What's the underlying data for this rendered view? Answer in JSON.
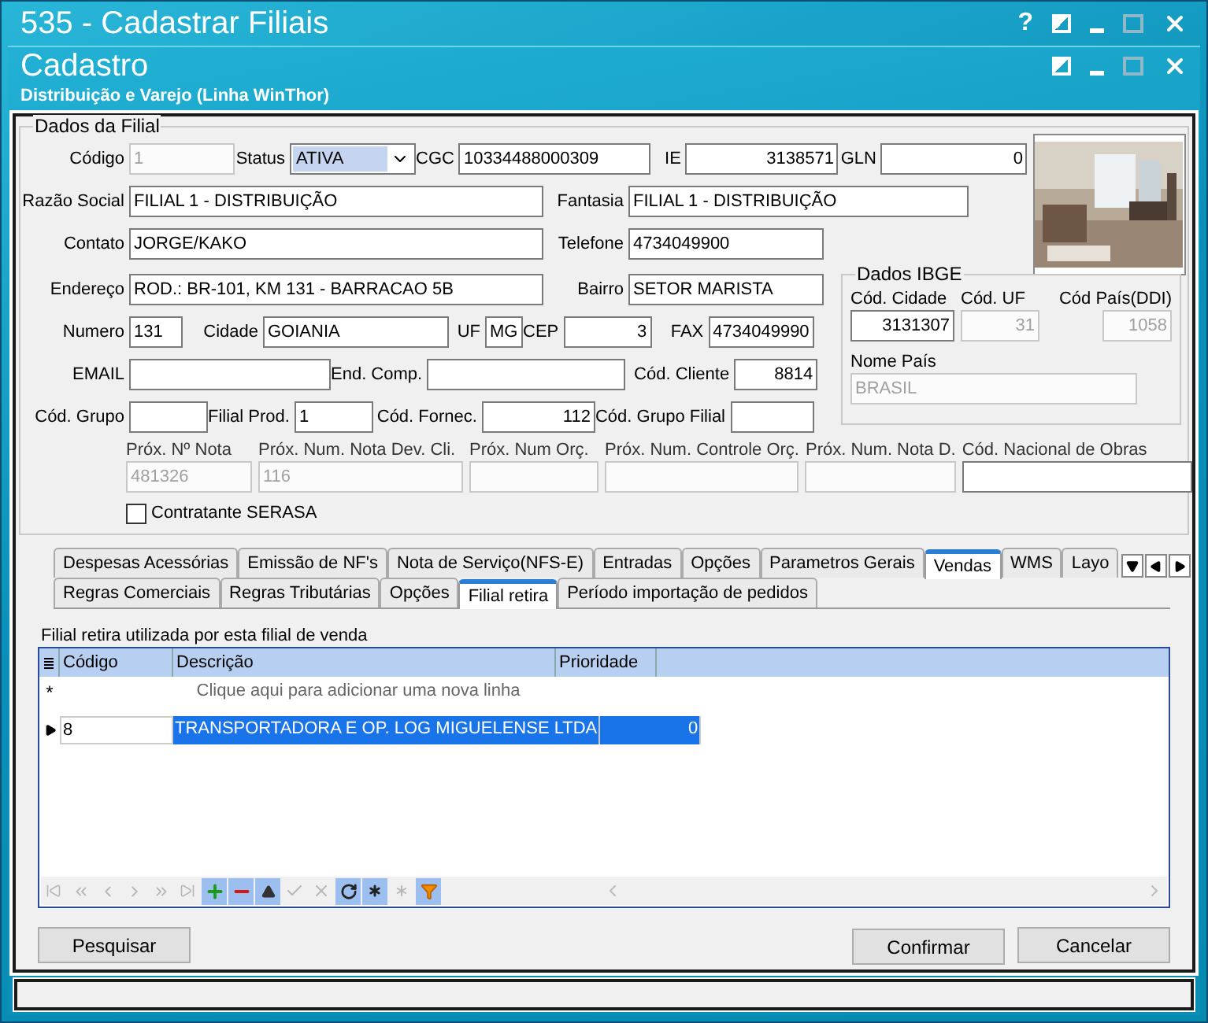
{
  "parent_window": {
    "title": "535 - Cadastrar Filiais",
    "help": "?"
  },
  "window": {
    "title": "Cadastro",
    "subtitle": "Distribuição e Varejo (Linha WinThor)",
    "maximize_disabled": true
  },
  "dados_filial": {
    "title": "Dados da Filial",
    "fields": {
      "codigo": {
        "label": "Código",
        "value": "1",
        "disabled": true
      },
      "status": {
        "label": "Status",
        "value": "ATIVA",
        "kind": "select"
      },
      "cgc": {
        "label": "CGC",
        "value": "10334488000309"
      },
      "ie": {
        "label": "IE",
        "value": "3138571"
      },
      "gln": {
        "label": "GLN",
        "value": "0"
      },
      "razao": {
        "label": "Razão Social",
        "value": "FILIAL 1 - DISTRIBUIÇÃO"
      },
      "fantasia": {
        "label": "Fantasia",
        "value": "FILIAL 1 - DISTRIBUIÇÃO"
      },
      "contato": {
        "label": "Contato",
        "value": "JORGE/KAKO"
      },
      "telefone": {
        "label": "Telefone",
        "value": "4734049900"
      },
      "endereco": {
        "label": "Endereço",
        "value": "ROD.: BR-101, KM 131 - BARRACAO 5B"
      },
      "bairro": {
        "label": "Bairro",
        "value": "SETOR MARISTA"
      },
      "numero": {
        "label": "Numero",
        "value": "131"
      },
      "cidade": {
        "label": "Cidade",
        "value": "GOIANIA"
      },
      "uf": {
        "label": "UF",
        "value": "MG"
      },
      "cep": {
        "label": "CEP",
        "value": "3"
      },
      "fax": {
        "label": "FAX",
        "value": "4734049990"
      },
      "email": {
        "label": "EMAIL"
      },
      "end_comp": {
        "label": "End. Comp."
      },
      "cod_cliente": {
        "label": "Cód. Cliente",
        "value": "8814"
      },
      "cod_grupo": {
        "label": "Cód. Grupo"
      },
      "filial_prod": {
        "label": "Filial Prod.",
        "value": "1"
      },
      "cod_fornec": {
        "label": "Cód. Fornec.",
        "value": "112"
      },
      "cod_grupo_filial": {
        "label": "Cód. Grupo Filial"
      }
    },
    "numbering": [
      {
        "label": "Próx. Nº Nota",
        "value": "481326",
        "disabled": true
      },
      {
        "label": "Próx. Num. Nota Dev. Cli.",
        "value": "116",
        "disabled": true
      },
      {
        "label": "Próx. Num Orç.",
        "disabled": true
      },
      {
        "label": "Próx. Num. Controle Orç.",
        "disabled": true
      },
      {
        "label": "Próx. Num. Nota D.",
        "disabled": true
      },
      {
        "label": "Cód. Nacional de Obras",
        "disabled": false
      }
    ],
    "serasa": {
      "label": "Contratante SERASA",
      "checked": false
    },
    "ibge": {
      "title": "Dados IBGE",
      "fields": [
        {
          "label": "Cód. Cidade",
          "value": "3131307",
          "disabled": false
        },
        {
          "label": "Cód. UF",
          "value": "31",
          "disabled": true
        },
        {
          "label": "Cód País(DDI)",
          "value": "1058",
          "disabled": true
        }
      ],
      "pais": {
        "label": "Nome País",
        "value": "BRASIL",
        "disabled": true
      }
    }
  },
  "tabs": [
    {
      "label": "Despesas Acessórias",
      "selected": false
    },
    {
      "label": "Emissão de NF's",
      "selected": false
    },
    {
      "label": "Nota de Serviço(NFS-E)",
      "selected": false
    },
    {
      "label": "Entradas",
      "selected": false
    },
    {
      "label": "Opções",
      "selected": false
    },
    {
      "label": "Parametros Gerais",
      "selected": false
    },
    {
      "label": "Vendas",
      "selected": true
    },
    {
      "label": "WMS",
      "selected": false
    },
    {
      "label": "Layo",
      "selected": false
    }
  ],
  "subtabs": [
    {
      "label": "Regras Comerciais",
      "selected": false
    },
    {
      "label": "Regras Tributárias",
      "selected": false
    },
    {
      "label": "Opções",
      "selected": false
    },
    {
      "label": "Filial retira",
      "selected": true
    },
    {
      "label": "Período importação de pedidos",
      "selected": false
    }
  ],
  "grid": {
    "caption": "Filial retira utilizada por esta filial de venda",
    "columns": [
      "Código",
      "Descrição",
      "Prioridade"
    ],
    "new_row": {
      "marker": "*",
      "text": "Clique aqui para adicionar uma nova linha"
    },
    "rows": [
      {
        "cells": [
          "8",
          "TRANSPORTADORA E OP. LOG MIGUELENSE LTDA",
          "0"
        ],
        "selected": true
      }
    ],
    "navigator": [
      {
        "kind": "first",
        "disabled": true
      },
      {
        "kind": "prev_page",
        "disabled": true
      },
      {
        "kind": "prev",
        "disabled": true
      },
      {
        "kind": "next",
        "disabled": true
      },
      {
        "kind": "next_page",
        "disabled": true
      },
      {
        "kind": "last",
        "disabled": true
      },
      {
        "kind": "add",
        "disabled": false
      },
      {
        "kind": "delete",
        "disabled": false
      },
      {
        "kind": "edit",
        "disabled": false
      },
      {
        "kind": "post",
        "disabled": true
      },
      {
        "kind": "cancel",
        "disabled": true
      },
      {
        "kind": "refresh",
        "disabled": false
      },
      {
        "kind": "bookmark",
        "disabled": false
      },
      {
        "kind": "goto_bookmark",
        "disabled": true
      },
      {
        "kind": "filter",
        "disabled": false
      }
    ]
  },
  "buttons": {
    "search": "Pesquisar",
    "confirm": "Confirmar",
    "cancel": "Cancelar"
  }
}
